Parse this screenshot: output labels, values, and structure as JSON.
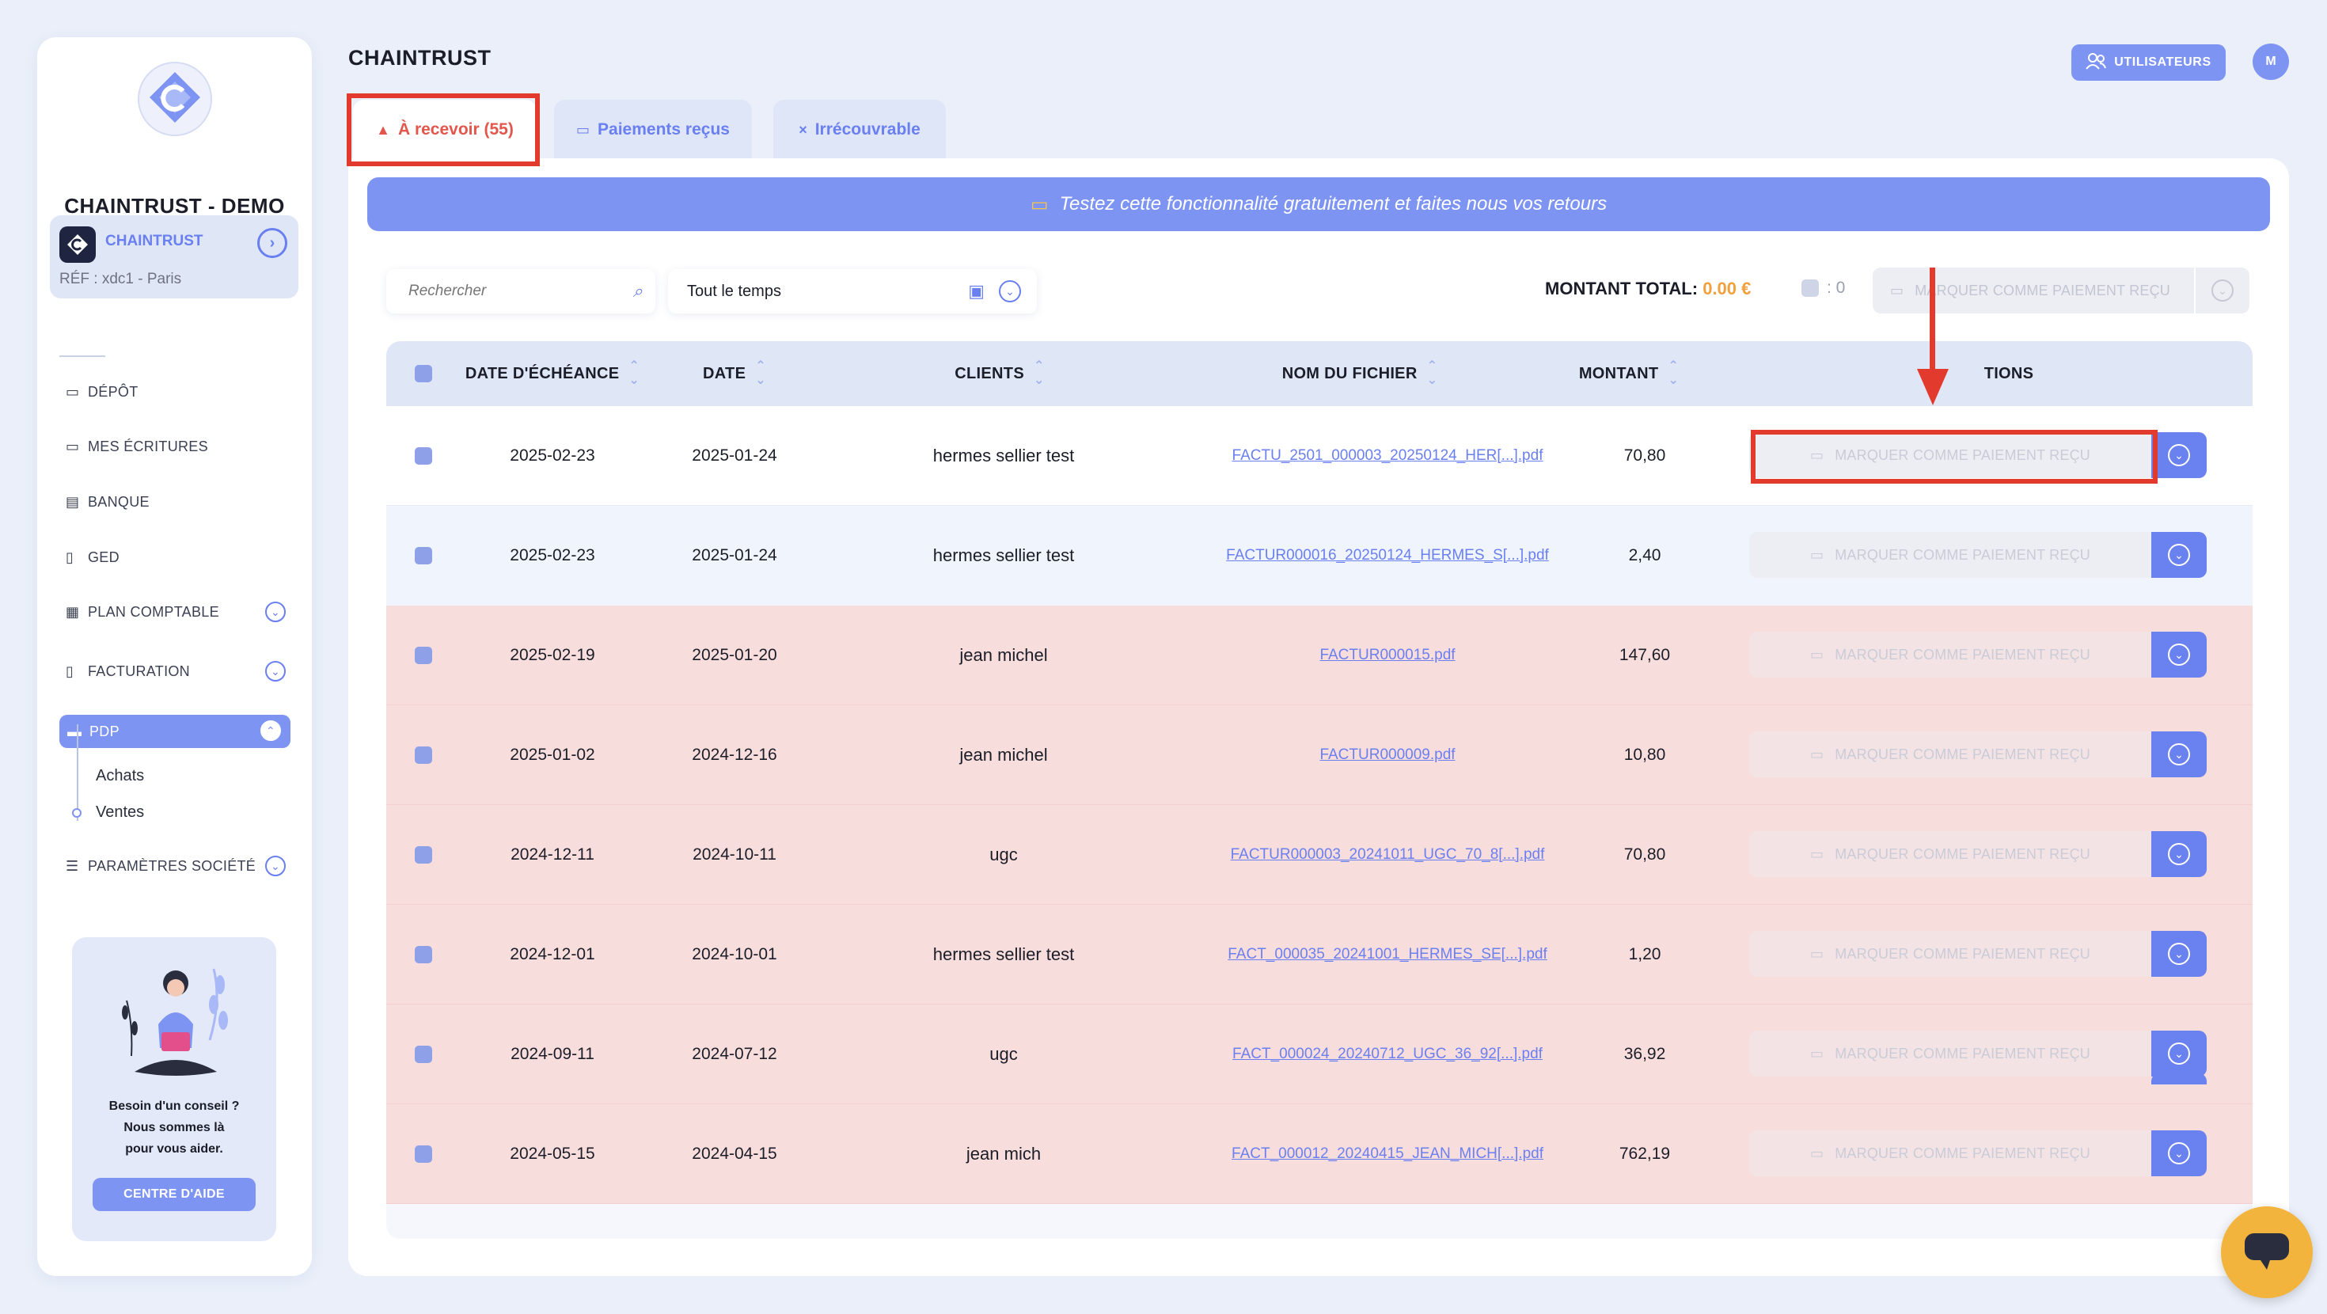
{
  "app": {
    "org_name": "CHAINTRUST - DEMO",
    "brand_title": "CHAINTRUST"
  },
  "sidebar": {
    "company": {
      "name": "CHAINTRUST",
      "ref": "RÉF : xdc1 - Paris"
    },
    "items": [
      {
        "label": "DÉPÔT",
        "icon": "folder-icon"
      },
      {
        "label": "MES ÉCRITURES",
        "icon": "folder-icon"
      },
      {
        "label": "BANQUE",
        "icon": "bank-icon"
      },
      {
        "label": "GED",
        "icon": "document-icon"
      },
      {
        "label": "PLAN COMPTABLE",
        "icon": "ledger-icon"
      },
      {
        "label": "FACTURATION",
        "icon": "invoice-icon"
      },
      {
        "label": "PDP",
        "icon": "card-icon"
      },
      {
        "label": "PARAMÈTRES SOCIÉTÉ",
        "icon": "settings-sliders-icon"
      }
    ],
    "pdp_sub": [
      "Achats",
      "Ventes"
    ],
    "help": {
      "line1": "Besoin d'un conseil ?",
      "line2": "Nous sommes là",
      "line3": "pour vous aider.",
      "button": "CENTRE D'AIDE"
    }
  },
  "header": {
    "users_button": "UTILISATEURS",
    "avatar_initial": "M"
  },
  "tabs": [
    {
      "label": "À recevoir (55)",
      "active": true
    },
    {
      "label": "Paiements reçus",
      "active": false
    },
    {
      "label": "Irrécouvrable",
      "active": false
    }
  ],
  "banner": {
    "text": "Testez cette fonctionnalité gratuitement et faites nous vos retours"
  },
  "toolbar": {
    "search_placeholder": "Rechercher",
    "period": "Tout le temps",
    "total_label": "MONTANT TOTAL:",
    "total_value": "0.00 €",
    "selected_count": ": 0",
    "bulk_button": "MARQUER COMME PAIEMENT REÇU"
  },
  "table": {
    "columns": [
      "DATE D'ÉCHÉANCE",
      "DATE",
      "CLIENTS",
      "NOM DU FICHIER",
      "MONTANT",
      "TIONS"
    ],
    "row_action": "MARQUER COMME PAIEMENT REÇU",
    "rows": [
      {
        "due": "2025-02-23",
        "date": "2025-01-24",
        "client": "hermes sellier test",
        "file": "FACTU_2501_000003_20250124_HER[...].pdf",
        "amount": "70,80",
        "overdue": false
      },
      {
        "due": "2025-02-23",
        "date": "2025-01-24",
        "client": "hermes sellier test",
        "file": "FACTUR000016_20250124_HERMES_S[...].pdf",
        "amount": "2,40",
        "overdue": false
      },
      {
        "due": "2025-02-19",
        "date": "2025-01-20",
        "client": "jean michel",
        "file": "FACTUR000015.pdf",
        "amount": "147,60",
        "overdue": true
      },
      {
        "due": "2025-01-02",
        "date": "2024-12-16",
        "client": "jean michel",
        "file": "FACTUR000009.pdf",
        "amount": "10,80",
        "overdue": true
      },
      {
        "due": "2024-12-11",
        "date": "2024-10-11",
        "client": "ugc",
        "file": "FACTUR000003_20241011_UGC_70_8[...].pdf",
        "amount": "70,80",
        "overdue": true
      },
      {
        "due": "2024-12-01",
        "date": "2024-10-01",
        "client": "hermes sellier test",
        "file": "FACT_000035_20241001_HERMES_SE[...].pdf",
        "amount": "1,20",
        "overdue": true
      },
      {
        "due": "2024-09-11",
        "date": "2024-07-12",
        "client": "ugc",
        "file": "FACT_000024_20240712_UGC_36_92[...].pdf",
        "amount": "36,92",
        "overdue": true
      },
      {
        "due": "2024-05-15",
        "date": "2024-04-15",
        "client": "jean mich",
        "file": "FACT_000012_20240415_JEAN_MICH[...].pdf",
        "amount": "762,19",
        "overdue": true
      }
    ]
  },
  "colors": {
    "accent": "#7d94f3",
    "overdue_row": "#f8dddd",
    "total_amount": "#f2a03c",
    "annotation": "#e23a2c",
    "chat_button": "#f2b43c"
  }
}
